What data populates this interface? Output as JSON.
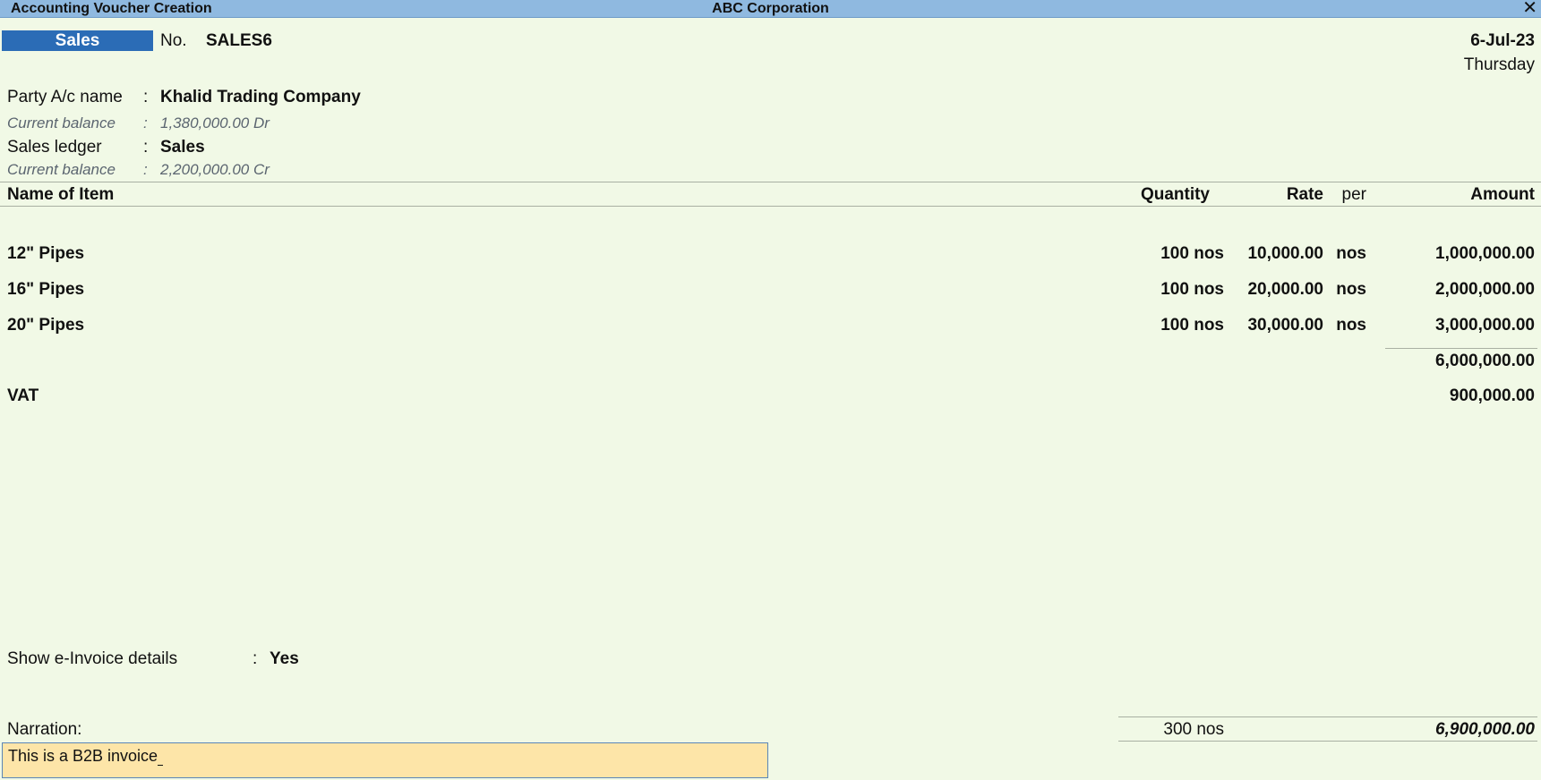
{
  "window": {
    "title": "Accounting Voucher Creation",
    "company": "ABC Corporation",
    "close_glyph": "✕"
  },
  "voucher": {
    "type": "Sales",
    "no_label": "No.",
    "number": "SALES6",
    "date": "6-Jul-23",
    "day": "Thursday"
  },
  "party": {
    "label": "Party A/c name",
    "sep": ":",
    "value": "Khalid Trading Company",
    "balance_label": "Current balance",
    "balance_value": "1,380,000.00 Dr"
  },
  "ledger": {
    "label": "Sales ledger",
    "sep": ":",
    "value": "Sales",
    "balance_label": "Current balance",
    "balance_value": "2,200,000.00 Cr"
  },
  "columns": {
    "name": "Name of Item",
    "quantity": "Quantity",
    "rate": "Rate",
    "per": "per",
    "amount": "Amount"
  },
  "items": [
    {
      "name": "12\" Pipes",
      "quantity": "100 nos",
      "rate": "10,000.00",
      "per": "nos",
      "amount": "1,000,000.00"
    },
    {
      "name": "16\" Pipes",
      "quantity": "100 nos",
      "rate": "20,000.00",
      "per": "nos",
      "amount": "2,000,000.00"
    },
    {
      "name": "20\" Pipes",
      "quantity": "100 nos",
      "rate": "30,000.00",
      "per": "nos",
      "amount": "3,000,000.00"
    }
  ],
  "subtotal": "6,000,000.00",
  "vat": {
    "name": "VAT",
    "amount": "900,000.00"
  },
  "einvoice": {
    "label": "Show e-Invoice details",
    "sep": ":",
    "value": "Yes"
  },
  "narration": {
    "label": "Narration:",
    "value": "This is a B2B invoice"
  },
  "totals": {
    "quantity": "300 nos",
    "amount": "6,900,000.00"
  }
}
